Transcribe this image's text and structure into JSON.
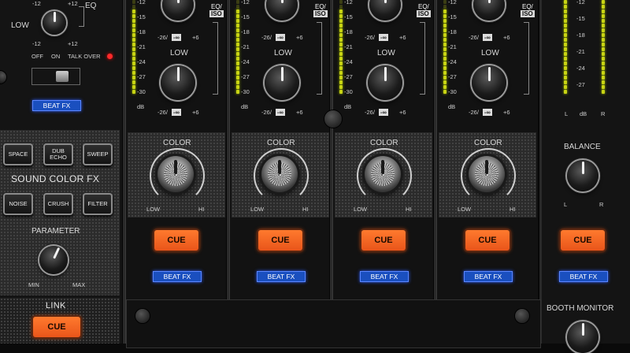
{
  "left_panel": {
    "eq_label": "EQ",
    "low_label": "LOW",
    "plus12_top": "+12",
    "minus12_top": "-12",
    "plus12_bottom": "+12",
    "minus12_bottom": "-12",
    "talkover": {
      "off": "OFF",
      "on": "ON",
      "talk_over": "TALK OVER"
    },
    "beat_fx": "BEAT FX",
    "sound_color_fx": {
      "title": "SOUND COLOR FX",
      "buttons": [
        "SPACE",
        "DUB ECHO",
        "SWEEP",
        "NOISE",
        "CRUSH",
        "FILTER"
      ]
    },
    "parameter": {
      "label": "PARAMETER",
      "min": "MIN",
      "max": "MAX"
    },
    "link": {
      "label": "LINK",
      "cue": "CUE"
    }
  },
  "meter_scale": [
    "-12",
    "-15",
    "-18",
    "-21",
    "-24",
    "-27",
    "-30",
    "dB"
  ],
  "channels": [
    {
      "eq_iso_top": "EQ/",
      "eq_iso_bottom": "ISO",
      "mid_label": "LOW",
      "range_min": "-26/",
      "range_inf": "-∞",
      "range_max": "+6",
      "color_label": "COLOR",
      "low": "LOW",
      "hi": "HI",
      "cue": "CUE",
      "beat_fx": "BEAT FX"
    },
    {
      "eq_iso_top": "EQ/",
      "eq_iso_bottom": "ISO",
      "mid_label": "LOW",
      "range_min": "-26/",
      "range_inf": "-∞",
      "range_max": "+6",
      "color_label": "COLOR",
      "low": "LOW",
      "hi": "HI",
      "cue": "CUE",
      "beat_fx": "BEAT FX"
    },
    {
      "eq_iso_top": "EQ/",
      "eq_iso_bottom": "ISO",
      "mid_label": "LOW",
      "range_min": "-26/",
      "range_inf": "-∞",
      "range_max": "+6",
      "color_label": "COLOR",
      "low": "LOW",
      "hi": "HI",
      "cue": "CUE",
      "beat_fx": "BEAT FX"
    },
    {
      "eq_iso_top": "EQ/",
      "eq_iso_bottom": "ISO",
      "mid_label": "LOW",
      "range_min": "-26/",
      "range_inf": "-∞",
      "range_max": "+6",
      "color_label": "COLOR",
      "low": "LOW",
      "hi": "HI",
      "cue": "CUE",
      "beat_fx": "BEAT FX"
    }
  ],
  "master": {
    "meter_scale": [
      "-12",
      "-15",
      "-18",
      "-21",
      "-24",
      "-27"
    ],
    "l": "L",
    "db": "dB",
    "r": "R",
    "balance": {
      "label": "BALANCE",
      "l": "L",
      "r": "R"
    },
    "cue": "CUE",
    "beat_fx": "BEAT FX",
    "booth_monitor": "BOOTH MONITOR"
  },
  "colors": {
    "cue": "#ff6a24",
    "beat_fx": "#1a4fbf",
    "meter_led": "#c8d414"
  }
}
